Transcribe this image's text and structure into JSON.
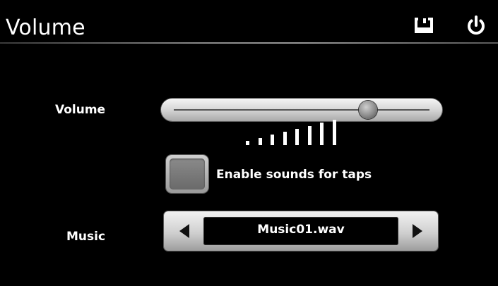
{
  "header": {
    "title": "Volume",
    "save_icon": "save-icon",
    "power_icon": "power-icon"
  },
  "volume": {
    "label": "Volume",
    "slider_value_fraction": 0.76,
    "level_indicator": {
      "bars_total": 8
    }
  },
  "tap_sound": {
    "label": "Enable sounds for taps",
    "checked": false
  },
  "music": {
    "label": "Music",
    "value": "Music01.wav",
    "prev_icon": "triangle-left-icon",
    "next_icon": "triangle-right-icon"
  },
  "colors": {
    "background": "#000000",
    "text": "#ffffff",
    "control_silver": "#cfcfcf"
  }
}
